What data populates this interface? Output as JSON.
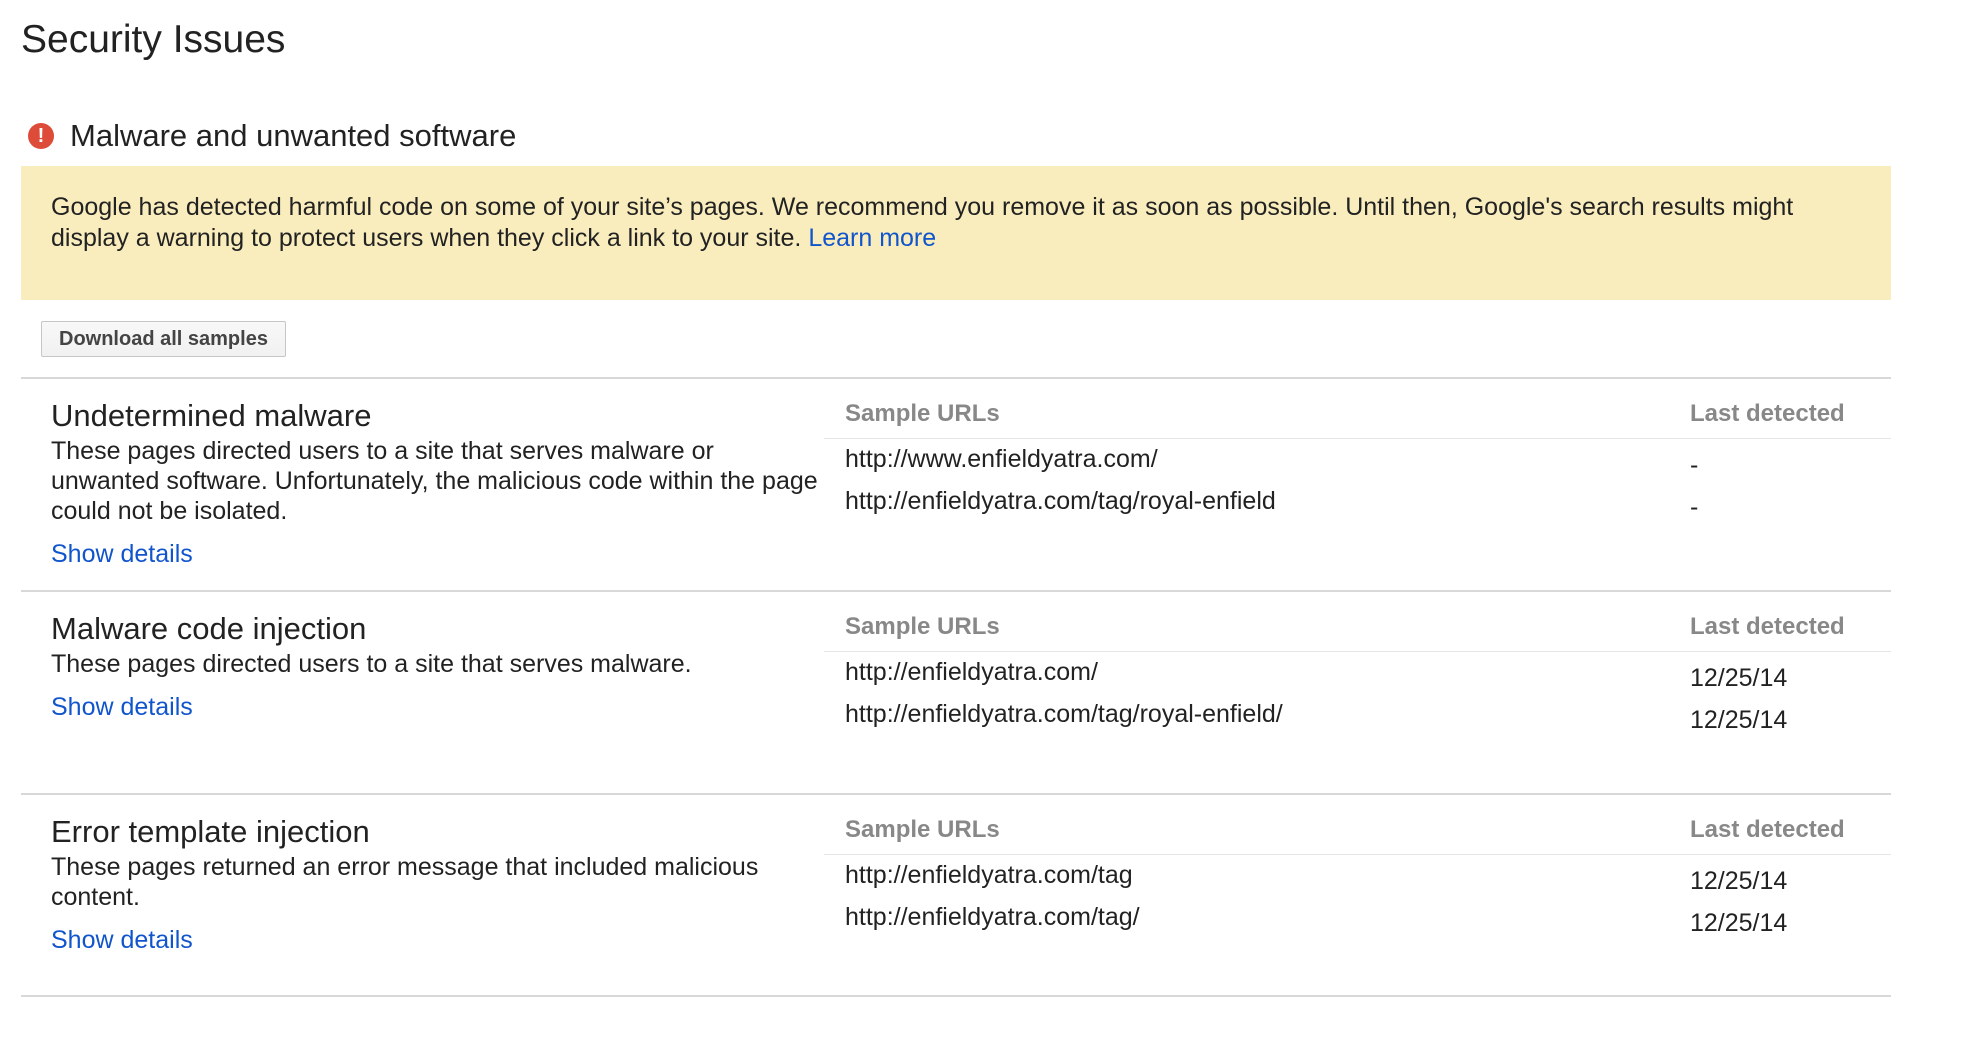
{
  "page": {
    "title": "Security Issues"
  },
  "section": {
    "icon": "alert-icon",
    "icon_glyph": "!",
    "title": "Malware and unwanted software",
    "alert_color": "#dd4b39"
  },
  "banner": {
    "text": "Google has detected harmful code on some of your site’s pages. We recommend you remove it as soon as possible. Until then, Google's search results might display a warning to protect users when they click a link to your site. ",
    "link_label": "Learn more",
    "background": "#f9edbe"
  },
  "toolbar": {
    "download_label": "Download all samples"
  },
  "table_headers": {
    "urls": "Sample URLs",
    "date": "Last detected"
  },
  "issues": [
    {
      "title": "Undetermined malware",
      "description": "These pages directed users to a site that serves malware or unwanted software. Unfortunately, the malicious code within the page could not be isolated.",
      "link": "Show details",
      "rows": [
        {
          "url": "http://www.enfieldyatra.com/",
          "date": "-"
        },
        {
          "url": "http://enfieldyatra.com/tag/royal-enfield",
          "date": "-"
        }
      ]
    },
    {
      "title": "Malware code injection",
      "description": "These pages directed users to a site that serves malware.",
      "link": "Show details",
      "rows": [
        {
          "url": "http://enfieldyatra.com/",
          "date": "12/25/14"
        },
        {
          "url": "http://enfieldyatra.com/tag/royal-enfield/",
          "date": "12/25/14"
        }
      ]
    },
    {
      "title": "Error template injection",
      "description": "These pages returned an error message that included malicious content.",
      "link": "Show details",
      "rows": [
        {
          "url": "http://enfieldyatra.com/tag",
          "date": "12/25/14"
        },
        {
          "url": "http://enfieldyatra.com/tag/",
          "date": "12/25/14"
        }
      ]
    }
  ],
  "colors": {
    "link": "#1155cc",
    "header_text": "#888888",
    "divider": "#d8d8d8"
  }
}
